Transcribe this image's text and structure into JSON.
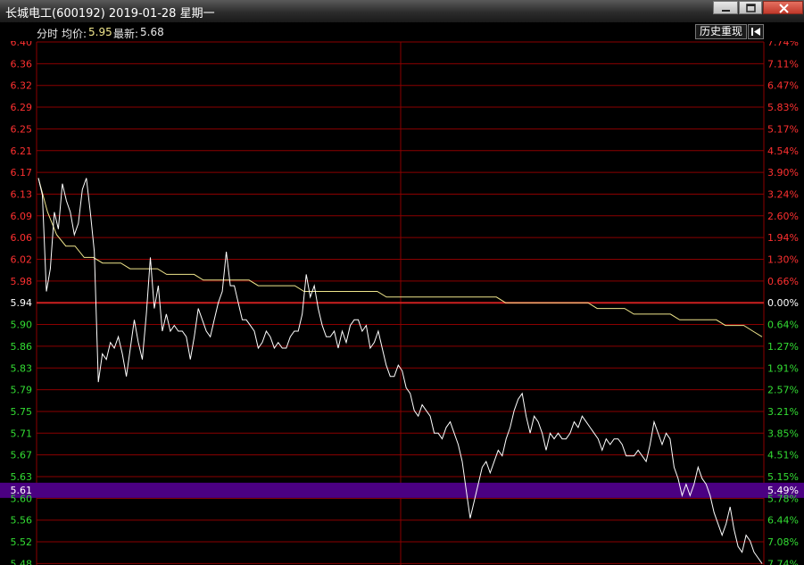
{
  "window": {
    "title": "长城电工(600192) 2019-01-28 星期一"
  },
  "info": {
    "mode_label": "分时",
    "avg_label": "均价:",
    "avg_value": "5.95",
    "latest_label": "最新:",
    "latest_value": "5.68",
    "history_button": "历史重现"
  },
  "chart_data": {
    "type": "line",
    "title": "",
    "baseline_price": 5.94,
    "ylim": [
      5.48,
      6.4
    ],
    "left_ticks": [
      "6.40",
      "6.36",
      "6.32",
      "6.29",
      "6.25",
      "6.21",
      "6.17",
      "6.13",
      "6.09",
      "6.06",
      "6.02",
      "5.98",
      "5.94",
      "5.90",
      "5.86",
      "5.83",
      "5.79",
      "5.75",
      "5.71",
      "5.67",
      "5.63",
      "5.60",
      "5.56",
      "5.52",
      "5.48"
    ],
    "right_ticks": [
      "7.74%",
      "7.11%",
      "6.47%",
      "5.83%",
      "5.17%",
      "4.54%",
      "3.90%",
      "3.24%",
      "2.60%",
      "1.94%",
      "1.30%",
      "0.66%",
      "0.00%",
      "0.64%",
      "1.27%",
      "1.91%",
      "2.57%",
      "3.21%",
      "3.85%",
      "4.51%",
      "5.15%",
      "5.78%",
      "6.44%",
      "7.08%",
      "7.74%"
    ],
    "current_marker": {
      "price": "5.61",
      "pct": "5.49%"
    },
    "colors": {
      "up": "#ff3030",
      "down": "#33dd33",
      "grid": "#8b0000",
      "price_line": "#ffffff",
      "avg_line": "#f0e68c",
      "marker": "#4b0082"
    },
    "series": [
      {
        "values": [
          6.16,
          6.13,
          5.96,
          6.0,
          6.1,
          6.07,
          6.15,
          6.12,
          6.1,
          6.06,
          6.08,
          6.14,
          6.16,
          6.1,
          6.03,
          5.8,
          5.85,
          5.84,
          5.87,
          5.86,
          5.88,
          5.85,
          5.81,
          5.86,
          5.91,
          5.87,
          5.84,
          5.92,
          6.02,
          5.93,
          5.97,
          5.89,
          5.92,
          5.89,
          5.9,
          5.89,
          5.89,
          5.88,
          5.84,
          5.88,
          5.93,
          5.91,
          5.89,
          5.88,
          5.91,
          5.94,
          5.96,
          6.03,
          5.97,
          5.97,
          5.94,
          5.91,
          5.91,
          5.9,
          5.89,
          5.86,
          5.87,
          5.89,
          5.88,
          5.86,
          5.87,
          5.86,
          5.86,
          5.88,
          5.89,
          5.89,
          5.92,
          5.99,
          5.95,
          5.97,
          5.93,
          5.9,
          5.88,
          5.88,
          5.89,
          5.86,
          5.89,
          5.87,
          5.9,
          5.91,
          5.91,
          5.89,
          5.9,
          5.86,
          5.87,
          5.89,
          5.86,
          5.83,
          5.81,
          5.81,
          5.83,
          5.82,
          5.79,
          5.78,
          5.75,
          5.74,
          5.76,
          5.75,
          5.74,
          5.71,
          5.71,
          5.7,
          5.72,
          5.73,
          5.71,
          5.69,
          5.66,
          5.61,
          5.56,
          5.59,
          5.62,
          5.65,
          5.66,
          5.64,
          5.66,
          5.68,
          5.67,
          5.7,
          5.72,
          5.75,
          5.77,
          5.78,
          5.74,
          5.71,
          5.74,
          5.73,
          5.71,
          5.68,
          5.71,
          5.7,
          5.71,
          5.7,
          5.7,
          5.71,
          5.73,
          5.72,
          5.74,
          5.73,
          5.72,
          5.71,
          5.7,
          5.68,
          5.7,
          5.69,
          5.7,
          5.7,
          5.69,
          5.67,
          5.67,
          5.67,
          5.68,
          5.67,
          5.66,
          5.69,
          5.73,
          5.71,
          5.69,
          5.71,
          5.7,
          5.65,
          5.63,
          5.6,
          5.62,
          5.6,
          5.62,
          5.65,
          5.63,
          5.62,
          5.6,
          5.57,
          5.55,
          5.53,
          5.55,
          5.58,
          5.54,
          5.51,
          5.5,
          5.53,
          5.52,
          5.5,
          5.49,
          5.48
        ]
      },
      {
        "name": "",
        "values": [
          6.16,
          6.1,
          6.06,
          6.04,
          6.04,
          6.02,
          6.02,
          6.01,
          6.01,
          6.01,
          6.0,
          6.0,
          6.0,
          6.0,
          5.99,
          5.99,
          5.99,
          5.99,
          5.98,
          5.98,
          5.98,
          5.98,
          5.98,
          5.98,
          5.97,
          5.97,
          5.97,
          5.97,
          5.97,
          5.96,
          5.96,
          5.96,
          5.96,
          5.96,
          5.96,
          5.96,
          5.96,
          5.96,
          5.95,
          5.95,
          5.95,
          5.95,
          5.95,
          5.95,
          5.95,
          5.95,
          5.95,
          5.95,
          5.95,
          5.95,
          5.95,
          5.94,
          5.94,
          5.94,
          5.94,
          5.94,
          5.94,
          5.94,
          5.94,
          5.94,
          5.94,
          5.93,
          5.93,
          5.93,
          5.93,
          5.92,
          5.92,
          5.92,
          5.92,
          5.92,
          5.91,
          5.91,
          5.91,
          5.91,
          5.91,
          5.9,
          5.9,
          5.9,
          5.89,
          5.88
        ]
      }
    ]
  }
}
